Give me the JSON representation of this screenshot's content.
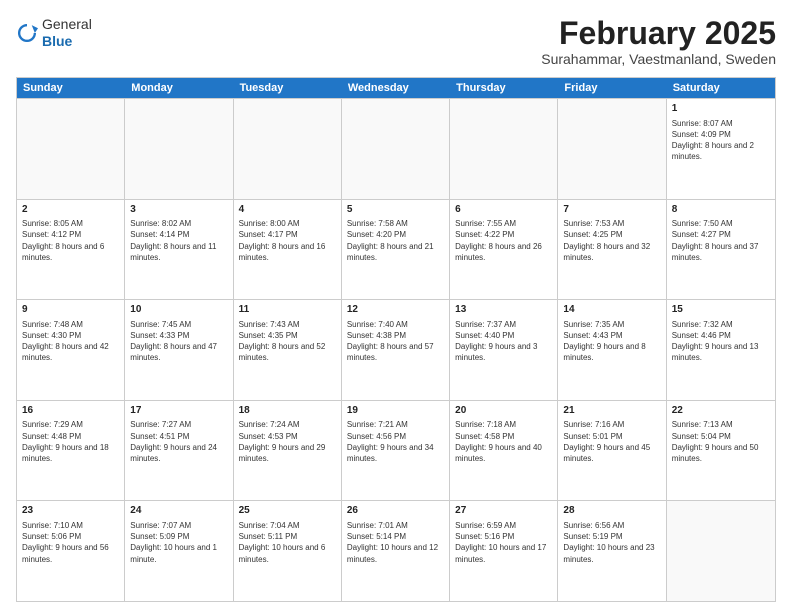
{
  "logo": {
    "general": "General",
    "blue": "Blue"
  },
  "header": {
    "month_year": "February 2025",
    "location": "Surahammar, Vaestmanland, Sweden"
  },
  "days_of_week": [
    "Sunday",
    "Monday",
    "Tuesday",
    "Wednesday",
    "Thursday",
    "Friday",
    "Saturday"
  ],
  "weeks": [
    [
      {
        "day": "",
        "text": "",
        "empty": true
      },
      {
        "day": "",
        "text": "",
        "empty": true
      },
      {
        "day": "",
        "text": "",
        "empty": true
      },
      {
        "day": "",
        "text": "",
        "empty": true
      },
      {
        "day": "",
        "text": "",
        "empty": true
      },
      {
        "day": "",
        "text": "",
        "empty": true
      },
      {
        "day": "1",
        "text": "Sunrise: 8:07 AM\nSunset: 4:09 PM\nDaylight: 8 hours and 2 minutes.",
        "empty": false
      }
    ],
    [
      {
        "day": "2",
        "text": "Sunrise: 8:05 AM\nSunset: 4:12 PM\nDaylight: 8 hours and 6 minutes.",
        "empty": false
      },
      {
        "day": "3",
        "text": "Sunrise: 8:02 AM\nSunset: 4:14 PM\nDaylight: 8 hours and 11 minutes.",
        "empty": false
      },
      {
        "day": "4",
        "text": "Sunrise: 8:00 AM\nSunset: 4:17 PM\nDaylight: 8 hours and 16 minutes.",
        "empty": false
      },
      {
        "day": "5",
        "text": "Sunrise: 7:58 AM\nSunset: 4:20 PM\nDaylight: 8 hours and 21 minutes.",
        "empty": false
      },
      {
        "day": "6",
        "text": "Sunrise: 7:55 AM\nSunset: 4:22 PM\nDaylight: 8 hours and 26 minutes.",
        "empty": false
      },
      {
        "day": "7",
        "text": "Sunrise: 7:53 AM\nSunset: 4:25 PM\nDaylight: 8 hours and 32 minutes.",
        "empty": false
      },
      {
        "day": "8",
        "text": "Sunrise: 7:50 AM\nSunset: 4:27 PM\nDaylight: 8 hours and 37 minutes.",
        "empty": false
      }
    ],
    [
      {
        "day": "9",
        "text": "Sunrise: 7:48 AM\nSunset: 4:30 PM\nDaylight: 8 hours and 42 minutes.",
        "empty": false
      },
      {
        "day": "10",
        "text": "Sunrise: 7:45 AM\nSunset: 4:33 PM\nDaylight: 8 hours and 47 minutes.",
        "empty": false
      },
      {
        "day": "11",
        "text": "Sunrise: 7:43 AM\nSunset: 4:35 PM\nDaylight: 8 hours and 52 minutes.",
        "empty": false
      },
      {
        "day": "12",
        "text": "Sunrise: 7:40 AM\nSunset: 4:38 PM\nDaylight: 8 hours and 57 minutes.",
        "empty": false
      },
      {
        "day": "13",
        "text": "Sunrise: 7:37 AM\nSunset: 4:40 PM\nDaylight: 9 hours and 3 minutes.",
        "empty": false
      },
      {
        "day": "14",
        "text": "Sunrise: 7:35 AM\nSunset: 4:43 PM\nDaylight: 9 hours and 8 minutes.",
        "empty": false
      },
      {
        "day": "15",
        "text": "Sunrise: 7:32 AM\nSunset: 4:46 PM\nDaylight: 9 hours and 13 minutes.",
        "empty": false
      }
    ],
    [
      {
        "day": "16",
        "text": "Sunrise: 7:29 AM\nSunset: 4:48 PM\nDaylight: 9 hours and 18 minutes.",
        "empty": false
      },
      {
        "day": "17",
        "text": "Sunrise: 7:27 AM\nSunset: 4:51 PM\nDaylight: 9 hours and 24 minutes.",
        "empty": false
      },
      {
        "day": "18",
        "text": "Sunrise: 7:24 AM\nSunset: 4:53 PM\nDaylight: 9 hours and 29 minutes.",
        "empty": false
      },
      {
        "day": "19",
        "text": "Sunrise: 7:21 AM\nSunset: 4:56 PM\nDaylight: 9 hours and 34 minutes.",
        "empty": false
      },
      {
        "day": "20",
        "text": "Sunrise: 7:18 AM\nSunset: 4:58 PM\nDaylight: 9 hours and 40 minutes.",
        "empty": false
      },
      {
        "day": "21",
        "text": "Sunrise: 7:16 AM\nSunset: 5:01 PM\nDaylight: 9 hours and 45 minutes.",
        "empty": false
      },
      {
        "day": "22",
        "text": "Sunrise: 7:13 AM\nSunset: 5:04 PM\nDaylight: 9 hours and 50 minutes.",
        "empty": false
      }
    ],
    [
      {
        "day": "23",
        "text": "Sunrise: 7:10 AM\nSunset: 5:06 PM\nDaylight: 9 hours and 56 minutes.",
        "empty": false
      },
      {
        "day": "24",
        "text": "Sunrise: 7:07 AM\nSunset: 5:09 PM\nDaylight: 10 hours and 1 minute.",
        "empty": false
      },
      {
        "day": "25",
        "text": "Sunrise: 7:04 AM\nSunset: 5:11 PM\nDaylight: 10 hours and 6 minutes.",
        "empty": false
      },
      {
        "day": "26",
        "text": "Sunrise: 7:01 AM\nSunset: 5:14 PM\nDaylight: 10 hours and 12 minutes.",
        "empty": false
      },
      {
        "day": "27",
        "text": "Sunrise: 6:59 AM\nSunset: 5:16 PM\nDaylight: 10 hours and 17 minutes.",
        "empty": false
      },
      {
        "day": "28",
        "text": "Sunrise: 6:56 AM\nSunset: 5:19 PM\nDaylight: 10 hours and 23 minutes.",
        "empty": false
      },
      {
        "day": "",
        "text": "",
        "empty": true
      }
    ]
  ]
}
